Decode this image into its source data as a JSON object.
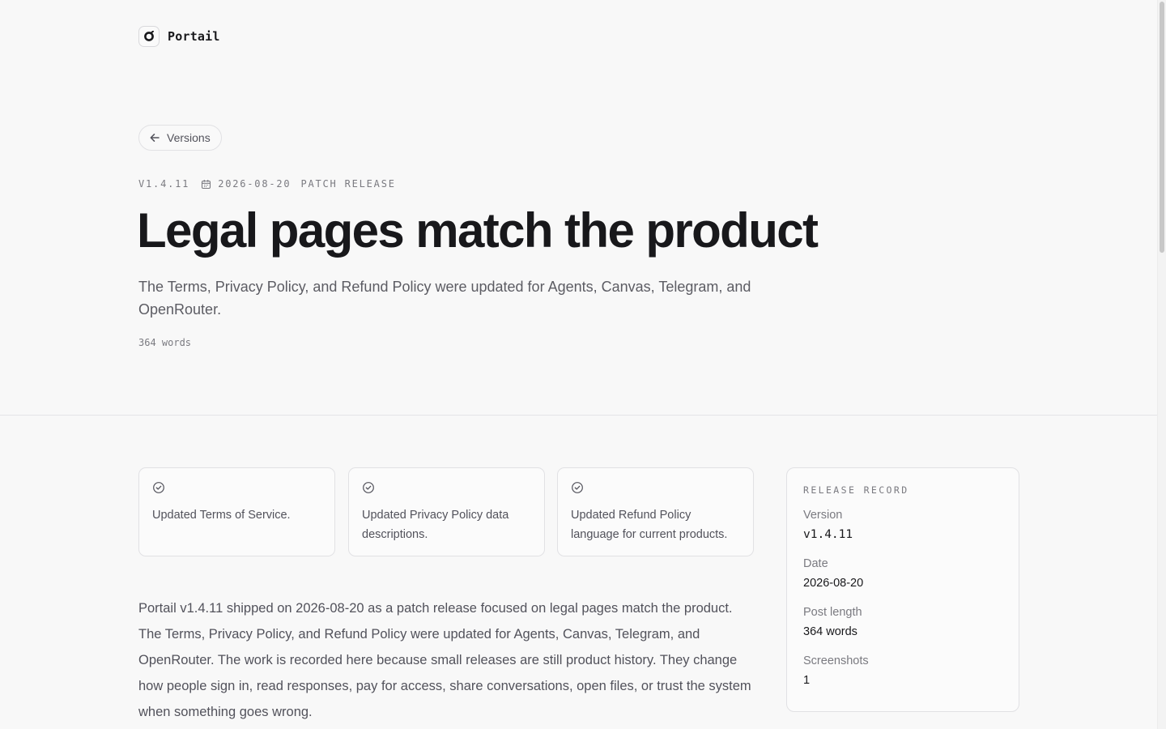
{
  "brand": {
    "name": "Portail",
    "logo_icon": "portail-logo-icon"
  },
  "nav": {
    "back_label": "Versions",
    "back_icon": "arrow-left-icon"
  },
  "post": {
    "version": "V1.4.11",
    "date": "2026-08-20",
    "date_icon": "calendar-icon",
    "kind": "PATCH RELEASE",
    "title": "Legal pages match the product",
    "subtitle": "The Terms, Privacy Policy, and Refund Policy were updated for Agents, Canvas, Telegram, and OpenRouter.",
    "word_count": "364 words"
  },
  "highlights": [
    {
      "icon": "check-circle-icon",
      "text": "Updated Terms of Service."
    },
    {
      "icon": "check-circle-icon",
      "text": "Updated Privacy Policy data descriptions."
    },
    {
      "icon": "check-circle-icon",
      "text": "Updated Refund Policy language for current products."
    }
  ],
  "body": "Portail v1.4.11 shipped on 2026-08-20 as a patch release focused on legal pages match the product. The Terms, Privacy Policy, and Refund Policy were updated for Agents, Canvas, Telegram, and OpenRouter. The work is recorded here because small releases are still product history. They change how people sign in, read responses, pay for access, share conversations, open files, or trust the system when something goes wrong.",
  "record": {
    "heading": "RELEASE RECORD",
    "version_label": "Version",
    "version_value": "v1.4.11",
    "date_label": "Date",
    "date_value": "2026-08-20",
    "length_label": "Post length",
    "length_value": "364 words",
    "screenshots_label": "Screenshots",
    "screenshots_value": "1"
  },
  "colors": {
    "text": "#18181b",
    "muted": "#52525b",
    "subtle": "#7a7a80",
    "border": "#e1e1e4",
    "background": "#f8f8f8"
  }
}
